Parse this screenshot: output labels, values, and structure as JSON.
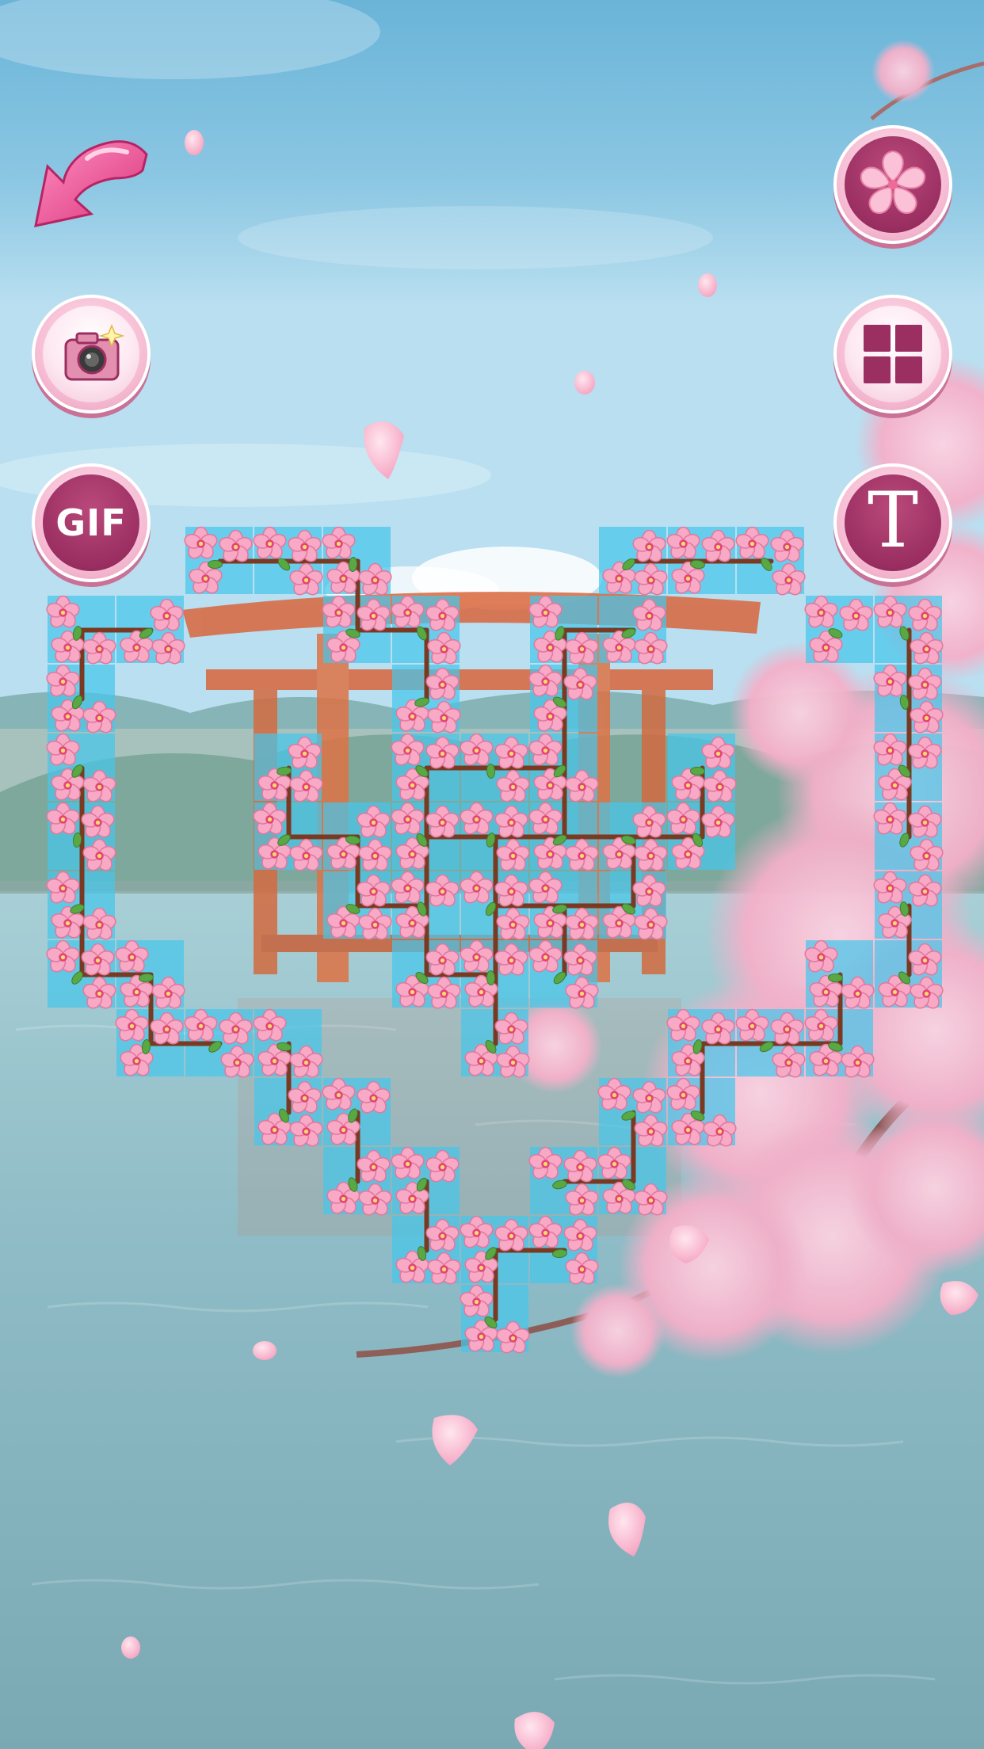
{
  "toolbar": {
    "gif_label": "GIF",
    "text_label": "T"
  },
  "icons": {
    "back": "back-arrow-icon",
    "camera": "camera-icon",
    "flower": "flower-icon",
    "grid": "grid-icon"
  },
  "colors": {
    "button_plum": "#9b2f62",
    "button_pink": "#f6bcd3",
    "tile_cyan": "#47c6ea",
    "blossom": "#f48cb1",
    "branch": "#7a3a22"
  }
}
